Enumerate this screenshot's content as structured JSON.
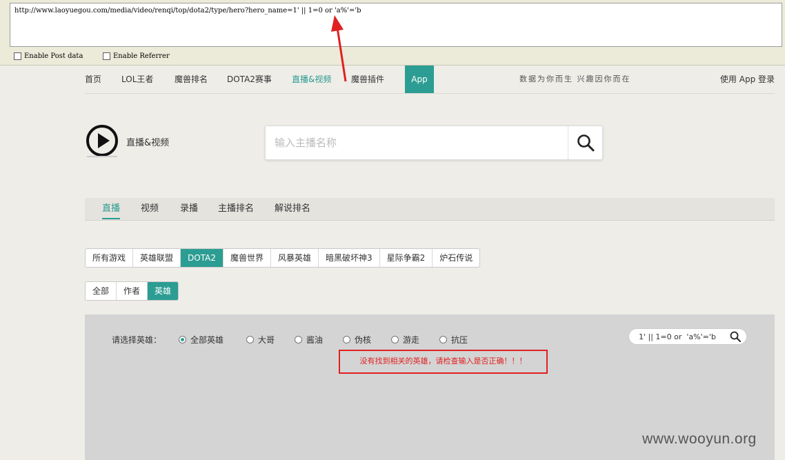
{
  "url_bar": {
    "value": "http://www.laoyuegou.com/media/video/renqi/top/dota2/type/hero?hero_name=1'  || 1=0 or  'a%'='b",
    "enable_post_data": "Enable Post data",
    "enable_referrer": "Enable Referrer"
  },
  "nav": {
    "items": [
      "首页",
      "LOL王者",
      "魔兽排名",
      "DOTA2赛事",
      "直播&视频",
      "魔兽插件"
    ],
    "active_index": 4,
    "app_label": "App",
    "slogan": "数据为你而生 兴趣因你而在",
    "login": "使用 App 登录"
  },
  "header": {
    "logo_text": "直播&视频",
    "search_placeholder": "输入主播名称"
  },
  "tabs": {
    "items": [
      "直播",
      "视频",
      "录播",
      "主播排名",
      "解说排名"
    ],
    "active_index": 0
  },
  "games": {
    "items": [
      "所有游戏",
      "英雄联盟",
      "DOTA2",
      "魔兽世界",
      "风暴英雄",
      "暗黑破坏神3",
      "星际争霸2",
      "炉石传说"
    ],
    "active_index": 2
  },
  "types": {
    "items": [
      "全部",
      "作者",
      "英雄"
    ],
    "active_index": 2
  },
  "filter": {
    "label": "请选择英雄：",
    "options": [
      "全部英雄",
      "大哥",
      "酱油",
      "伪核",
      "游走",
      "抗压"
    ],
    "checked_index": 0,
    "hero_search_value": "1' || 1=0 or  'a%'='b",
    "error_message": "没有找到相关的英雄，请检查输入是否正确！！！"
  },
  "watermark": "www.wooyun.org",
  "colors": {
    "accent": "#2c9d93",
    "error": "#e02020"
  }
}
